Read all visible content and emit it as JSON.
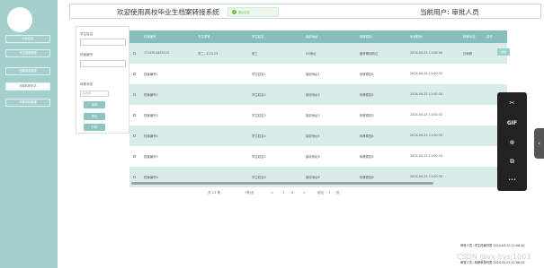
{
  "sidebar": {
    "items": [
      {
        "label": "公告信息",
        "active": false
      },
      {
        "label": "学生档案管理",
        "active": false
      },
      {
        "label": "档案接收管理",
        "active": false
      },
      {
        "label": "档案转移申请",
        "active": true
      },
      {
        "label": "转移审核管理",
        "active": false
      }
    ]
  },
  "header": {
    "title": "欢迎使用高校毕业生档案转接系统",
    "toast": "提示信息",
    "current_user": "当前用户: 审批人员"
  },
  "filter": {
    "student_name_label": "学生姓名",
    "archive_no_label": "档案编号",
    "status_label": "转移状态",
    "status_placeholder": "请选择",
    "search_button": "查询",
    "export_button": "导出",
    "print_button": "打印"
  },
  "table": {
    "headers": [
      "档案编号",
      "学生学号",
      "学生姓名",
      "接收地址",
      "转移原因",
      "申请时间",
      "转移状态",
      "操作"
    ],
    "rows": [
      {
        "archive_no": "1714914403123",
        "student_no": "学二--113123",
        "name": "张三",
        "address": "XX地址",
        "reason": "备考期间转过",
        "time": "2024-04-25 11:08:09",
        "status": "已转移",
        "action": "详情"
      },
      {
        "archive_no": "档案编号1",
        "student_no": "",
        "name": "学生姓名1",
        "address": "接收地址1",
        "reason": "转移原因1",
        "time": "2024-04-25 11:00:33",
        "status": "",
        "action": ""
      },
      {
        "archive_no": "档案编号2",
        "student_no": "",
        "name": "学生姓名2",
        "address": "接收地址2",
        "reason": "转移原因2",
        "time": "2024-04-25 11:00:33",
        "status": "",
        "action": ""
      },
      {
        "archive_no": "档案编号3",
        "student_no": "",
        "name": "学生姓名3",
        "address": "接收地址3",
        "reason": "转移原因3",
        "time": "2024-04-25 11:00:33",
        "status": "",
        "action": ""
      },
      {
        "archive_no": "档案编号4",
        "student_no": "",
        "name": "学生姓名4",
        "address": "接收地址4",
        "reason": "转移原因4",
        "time": "2024-04-25 11:00:33",
        "status": "",
        "action": ""
      },
      {
        "archive_no": "档案编号5",
        "student_no": "",
        "name": "学生姓名5",
        "address": "接收地址5",
        "reason": "转移原因5",
        "time": "2024-04-25 11:00:33",
        "status": "",
        "action": ""
      },
      {
        "archive_no": "档案编号6",
        "student_no": "",
        "name": "学生姓名6",
        "address": "接收地址6",
        "reason": "转移原因6",
        "time": "2024-04-25 11:00:33",
        "status": "",
        "action": ""
      }
    ]
  },
  "pagination": {
    "total": "共 13 条",
    "page_size": "7条/页",
    "prev": "<",
    "pages": [
      "1",
      "2"
    ],
    "current_page": "2",
    "next": ">",
    "goto_prefix": "前往",
    "goto_value": "1",
    "goto_suffix": "页"
  },
  "tools": {
    "icons": [
      "scissors-icon",
      "gif-icon",
      "search-zoom-icon",
      "crop-icon",
      "more-icon"
    ],
    "glyphs": [
      "✂",
      "GIF",
      "⊕",
      "⧉",
      "•••"
    ],
    "side_tab": "‹"
  },
  "notifications": [
    {
      "text": "审核人员--学生档案列表",
      "time": "2024-04-25 11:08:40"
    },
    {
      "text": "审核人员--转移审核列表",
      "time": "2024-04-25 11:08:45"
    }
  ],
  "watermark": "CSDN @vx-bysj1003",
  "colors": {
    "sidebar": "#a3cfcd",
    "table_header": "#84bfbc",
    "row_alt": "#d9ecea",
    "accent": "#8ec4c2"
  }
}
